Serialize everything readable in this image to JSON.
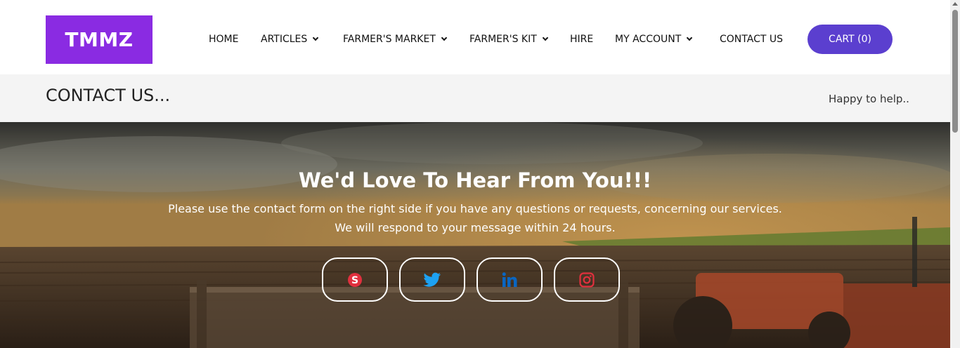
{
  "brand": {
    "logo_text": "TMMZ",
    "color": "#8a2be2"
  },
  "nav": {
    "items": [
      {
        "label": "HOME",
        "has_dropdown": false
      },
      {
        "label": "ARTICLES",
        "has_dropdown": true
      },
      {
        "label": "FARMER'S MARKET",
        "has_dropdown": true
      },
      {
        "label": "FARMER'S KIT",
        "has_dropdown": true
      },
      {
        "label": "HIRE",
        "has_dropdown": false
      },
      {
        "label": "MY ACCOUNT",
        "has_dropdown": true
      },
      {
        "label": "CONTACT US",
        "has_dropdown": false
      }
    ],
    "cart_label": "CART (0)",
    "cart_color": "#5b3fcf"
  },
  "title_band": {
    "title": "CONTACT US...",
    "subtitle": "Happy to help.."
  },
  "hero": {
    "heading": "We'd Love To Hear From You!!!",
    "line1": "Please use the contact form on the right side if you have any questions or requests, concerning our services.",
    "line2": "We will respond to your message within 24 hours.",
    "social": [
      {
        "icon": "skype-icon",
        "color": "#e0303e"
      },
      {
        "icon": "twitter-icon",
        "color": "#1da1f2"
      },
      {
        "icon": "linkedin-icon",
        "color": "#0a66c2"
      },
      {
        "icon": "instagram-icon",
        "color": "#e0303e"
      }
    ]
  }
}
